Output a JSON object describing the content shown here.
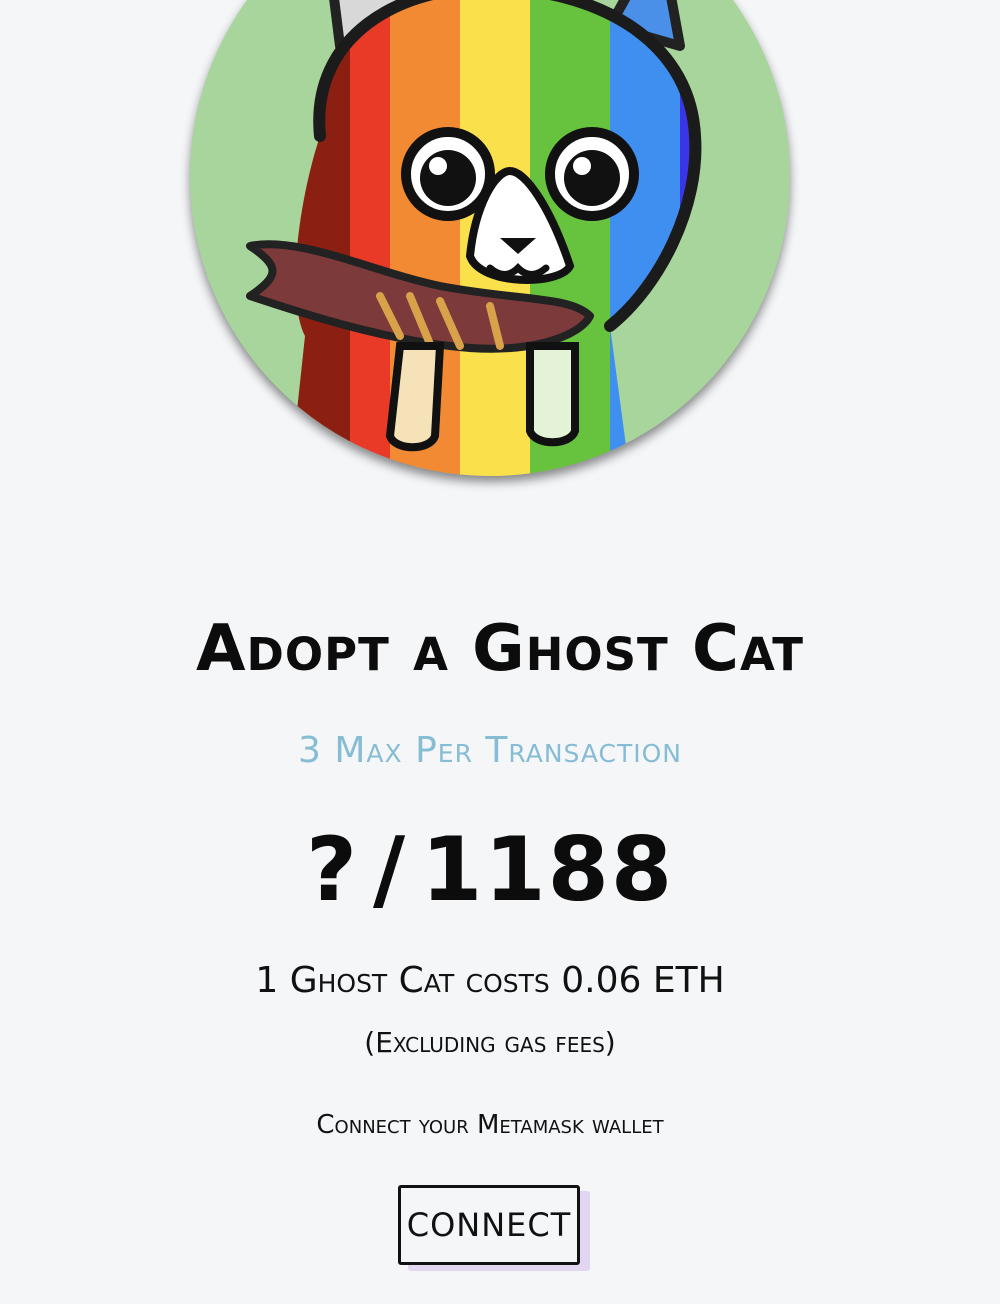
{
  "hero": {
    "alt": "Rainbow ghost cat with scarf"
  },
  "header": {
    "title": "Adopt a Ghost Cat",
    "subtitle": "3 Max Per Transaction"
  },
  "supply": {
    "minted": "?",
    "separator": "/",
    "total": "1188"
  },
  "pricing": {
    "price_text": "1 Ghost Cat costs 0.06 ETH",
    "note": "(Excluding gas fees)"
  },
  "wallet": {
    "prompt": "Connect your Metamask wallet",
    "connect_label": "CONNECT"
  },
  "colors": {
    "background": "#f5f6f8",
    "hero_bg": "#a8d59c",
    "subtitle": "#86bcd4",
    "text": "#111111"
  }
}
